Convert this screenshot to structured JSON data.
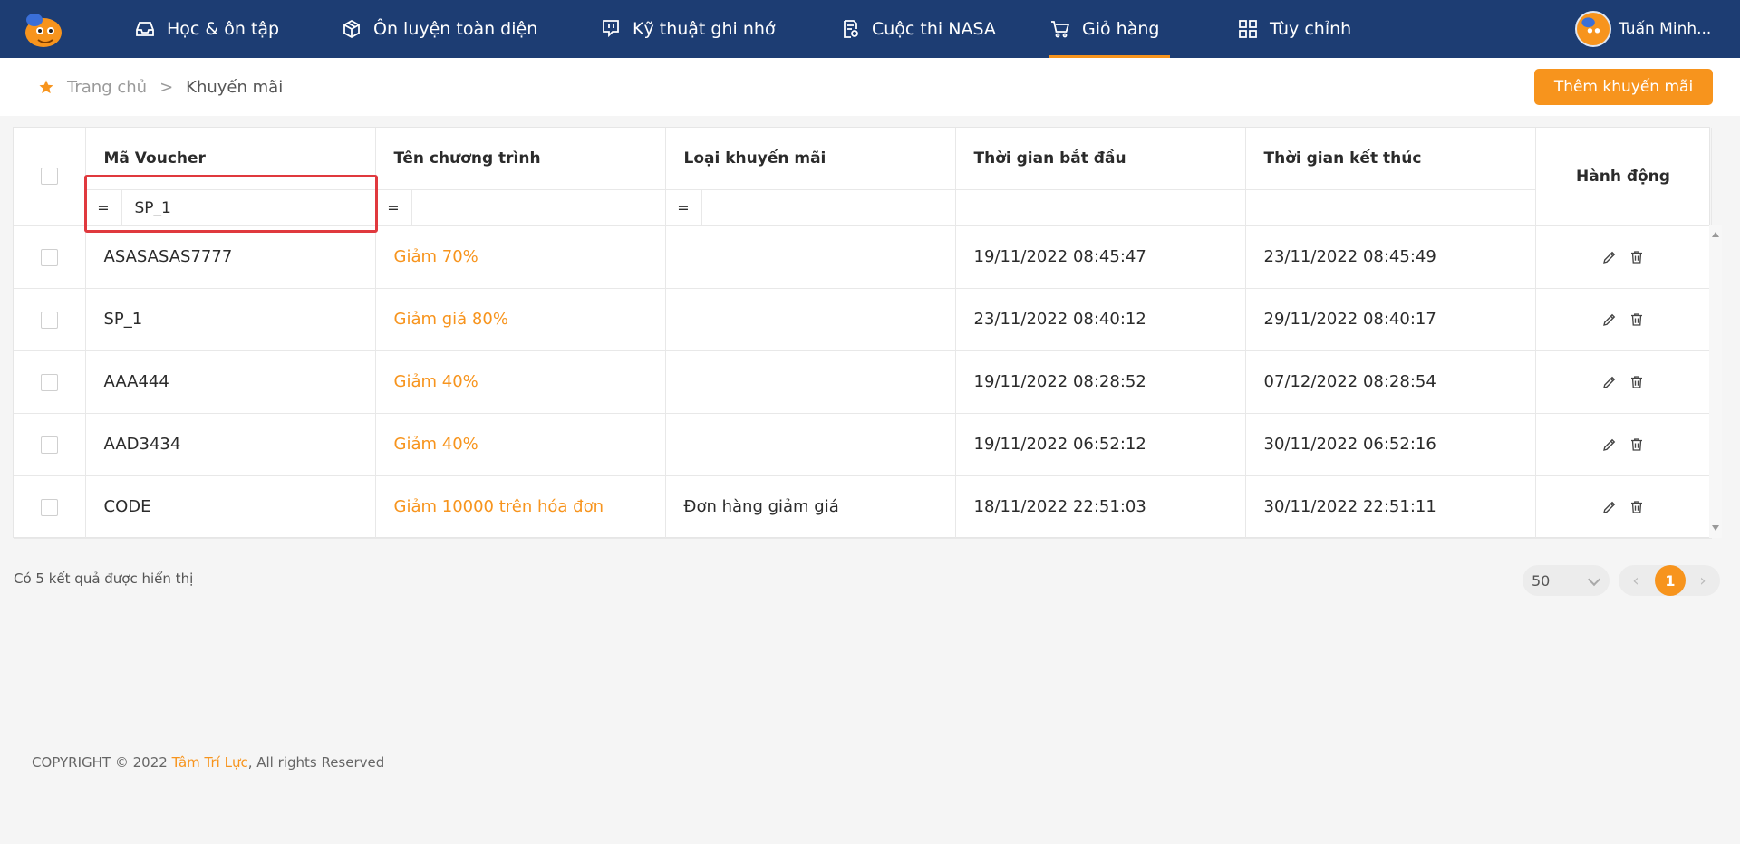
{
  "nav": {
    "items": [
      {
        "label": "Học & ôn tập",
        "icon": "inbox-icon"
      },
      {
        "label": "Ôn luyện toàn diện",
        "icon": "box-icon"
      },
      {
        "label": "Kỹ thuật ghi nhớ",
        "icon": "chat-icon"
      },
      {
        "label": "Cuộc thi NASA",
        "icon": "document-icon"
      },
      {
        "label": "Giỏ hàng",
        "icon": "cart-icon",
        "active": true
      },
      {
        "label": "Tùy chỉnh",
        "icon": "grid-icon"
      }
    ],
    "user_name": "Tuấn Minh..."
  },
  "breadcrumb": {
    "home": "Trang chủ",
    "separator": ">",
    "current": "Khuyến mãi"
  },
  "toolbar": {
    "add_label": "Thêm khuyến mãi"
  },
  "table": {
    "headers": {
      "voucher": "Mã Voucher",
      "program": "Tên chương trình",
      "type": "Loại khuyến mãi",
      "start": "Thời gian bắt đầu",
      "end": "Thời gian kết thúc",
      "actions": "Hành động"
    },
    "filters": {
      "operator": "=",
      "voucher_value": "SP_1",
      "program_value": "",
      "type_value": ""
    },
    "rows": [
      {
        "voucher": "ASASASAS7777",
        "program": "Giảm 70%",
        "type": "",
        "start": "19/11/2022 08:45:47",
        "end": "23/11/2022 08:45:49"
      },
      {
        "voucher": "SP_1",
        "program": "Giảm giá 80%",
        "type": "",
        "start": "23/11/2022 08:40:12",
        "end": "29/11/2022 08:40:17"
      },
      {
        "voucher": "AAA444",
        "program": "Giảm 40%",
        "type": "",
        "start": "19/11/2022 08:28:52",
        "end": "07/12/2022 08:28:54"
      },
      {
        "voucher": "AAD3434",
        "program": "Giảm 40%",
        "type": "",
        "start": "19/11/2022 06:52:12",
        "end": "30/11/2022 06:52:16"
      },
      {
        "voucher": "CODE",
        "program": "Giảm 10000 trên hóa đơn",
        "type": "Đơn hàng giảm giá",
        "start": "18/11/2022 22:51:03",
        "end": "30/11/2022 22:51:11"
      }
    ]
  },
  "footer": {
    "result_text": "Có 5 kết quả được hiển thị",
    "page_size": "50",
    "current_page": "1",
    "prev": "‹",
    "next": "›",
    "copyright_prefix": "COPYRIGHT © 2022 ",
    "brand": "Tâm Trí Lực",
    "copyright_suffix": ", All rights Reserved"
  },
  "colors": {
    "nav_bg": "#1d3d73",
    "accent": "#f7941d",
    "highlight": "#e0393e"
  }
}
